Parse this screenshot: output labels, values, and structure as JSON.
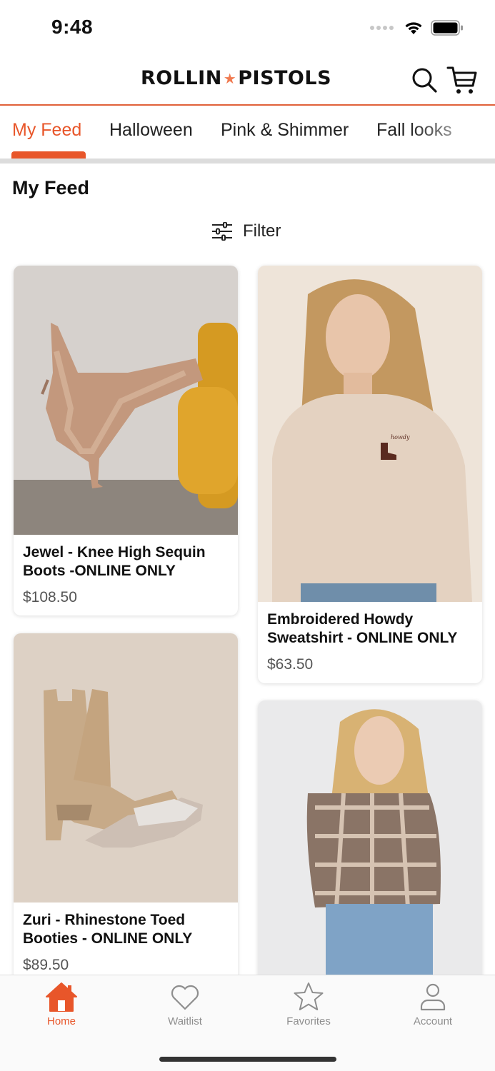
{
  "status_bar": {
    "time": "9:48"
  },
  "header": {
    "logo_left": "ROLLIN",
    "logo_star": "★",
    "logo_right": "PISTOLS"
  },
  "tabs": [
    {
      "label": "My Feed",
      "active": true
    },
    {
      "label": "Halloween"
    },
    {
      "label": "Pink & Shimmer"
    },
    {
      "label": "Fall looks"
    }
  ],
  "page": {
    "title": "My Feed",
    "filter_label": "Filter"
  },
  "products": [
    {
      "name": "Jewel - Knee High Sequin Boots -ONLINE ONLY",
      "price": "$108.50"
    },
    {
      "name": "Embroidered Howdy Sweatshirt - ONLINE ONLY",
      "price": "$63.50"
    },
    {
      "name": "Zuri - Rhinestone Toed Booties - ONLINE ONLY",
      "price": "$89.50"
    },
    {
      "name": "",
      "price": ""
    }
  ],
  "bottom_nav": [
    {
      "label": "Home",
      "icon": "home-icon",
      "active": true
    },
    {
      "label": "Waitlist",
      "icon": "heart-icon"
    },
    {
      "label": "Favorites",
      "icon": "star-icon"
    },
    {
      "label": "Account",
      "icon": "person-icon"
    }
  ],
  "colors": {
    "accent": "#e8562a",
    "divider": "#dcdcdc"
  }
}
